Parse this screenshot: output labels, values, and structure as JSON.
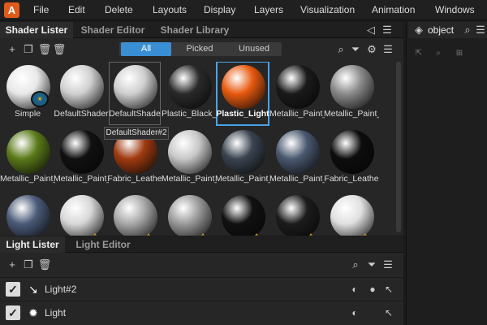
{
  "app": {
    "logo": "A"
  },
  "menu": [
    "File",
    "Edit",
    "Delete",
    "Layouts",
    "Display",
    "Layers",
    "Visualization",
    "Animation",
    "Windows"
  ],
  "shader_panel": {
    "tabs": [
      "Shader Lister",
      "Shader Editor",
      "Shader Library"
    ],
    "filters": [
      "All",
      "Picked",
      "Unused"
    ],
    "active_filter": "All",
    "icons": {
      "add": "plus-icon",
      "duplicate": "duplicate-icon",
      "delete_unused": "delete-unused-icon",
      "delete": "trash-icon",
      "search": "search-icon",
      "filter": "filter-icon",
      "settings": "gear-icon",
      "menu": "menu-icon",
      "back": "back-arrow-icon"
    },
    "tooltip": "DefaultShader#2",
    "row1": [
      {
        "label": "Simple",
        "color": "#e8e8e8"
      },
      {
        "label": "DefaultShader",
        "color": "#d0d0d0"
      },
      {
        "label": "DefaultShade",
        "color": "#cfcfcf"
      },
      {
        "label": "Plastic_Black_",
        "color": "#2a2a2a"
      },
      {
        "label": "Plastic_Light",
        "color": "#e85a10"
      },
      {
        "label": "Metallic_Paint_",
        "color": "#1a1a1a"
      },
      {
        "label": "Metallic_Paint_",
        "color": "#8a8a8a"
      }
    ],
    "row2": [
      {
        "label": "Metallic_Paint_",
        "color": "#5a7a1a"
      },
      {
        "label": "Metallic_Paint_",
        "color": "#111111"
      },
      {
        "label": "Fabric_Leathe",
        "color": "#a03a10"
      },
      {
        "label": "Metallic_Paint_",
        "color": "#c8c8c8"
      },
      {
        "label": "Metallic_Paint_",
        "color": "#3a4450"
      },
      {
        "label": "Metallic_Paint_",
        "color": "#4a5870"
      },
      {
        "label": "Fabric_Leathe",
        "color": "#0d0d0d"
      }
    ],
    "row3": [
      {
        "color": "#4a5a78"
      },
      {
        "color": "#d8d8d8"
      },
      {
        "color": "#a8a8a8"
      },
      {
        "color": "#9a9a9a"
      },
      {
        "color": "#111111"
      },
      {
        "color": "#1c1c1c"
      },
      {
        "color": "#e0e0e0"
      }
    ]
  },
  "light_panel": {
    "tabs": [
      "Light Lister",
      "Light Editor"
    ],
    "lights": [
      {
        "label": "Light#2",
        "icon": "directional-light-icon",
        "glyph": "↘"
      },
      {
        "label": "Light",
        "icon": "point-light-icon",
        "glyph": "✹"
      }
    ]
  },
  "right_panel": {
    "search_value": "object"
  }
}
